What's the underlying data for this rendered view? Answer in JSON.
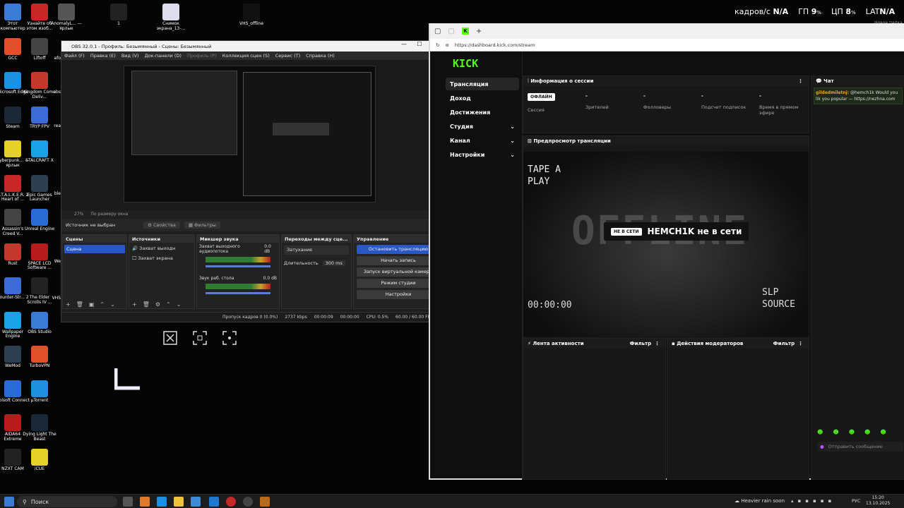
{
  "desktop": {
    "icons_col1": [
      "Этот компьютер",
      "GCC",
      "Microsoft Edge",
      "Steam",
      "Cyberpunk... — ярлык",
      "S.T.A.L.K.E.R. 2 Heart of ...",
      "Assassin's Creed V...",
      "Rust",
      "Counter-Str... 2",
      "Wallpaper Engine",
      "WeMod",
      "Ubisoft Connect",
      "AIDA64 Extreme",
      "NZXT CAM"
    ],
    "icons_col2": [
      "Узнайте об этом изоб...",
      "Liftoff",
      "Kingdom Come Deliv...",
      "TRYP FPV",
      "STALCRAFT X",
      "Epic Games Launcher",
      "Unreal Engine",
      "SPACE LCD Software ...",
      "The Elder Scrolls IV ...",
      "OBS Studio",
      "TurboVPN",
      "µTorrent",
      "Dying Light The Beast",
      "iCUE"
    ],
    "icons_top": [
      "AnomalyL... — ярлык",
      "1",
      "Снимок экрана_13-...",
      "VHS_offline"
    ],
    "col3_partial": [
      "afo",
      "abs",
      "rea",
      "ble",
      "We",
      "VHS"
    ],
    "overlay": {
      "fps_label": "кадров/с",
      "fps_value": "N/A",
      "gpu_label": "ГП",
      "gpu_value": "9",
      "cpu_label": "ЦП",
      "cpu_value": "8",
      "lat_label": "LAT",
      "lat_value": "N/A",
      "pct": "%",
      "right_note": "Новое папка"
    },
    "preview_overlay_icons": [
      "close-square",
      "fullscreen",
      "select-region"
    ]
  },
  "obs": {
    "title": "OBS 32.0.1 - Профиль: Безымянный - Сцены: Безымянный",
    "menu": [
      "Файл (F)",
      "Правка (E)",
      "Вид (V)",
      "Док-панели (D)",
      "Профиль (P)",
      "Коллекция сцен (S)",
      "Сервис (T)",
      "Справка (H)"
    ],
    "zoom": "27%",
    "zoom_mode": "По размеру окна",
    "source_none": "Источник не выбран",
    "props_btn": "Свойства",
    "filters_btn": "Фильтры",
    "docks": {
      "scenes": "Сцены",
      "sources": "Источники",
      "mixer": "Микшер звука",
      "transitions": "Переходы между сце...",
      "controls": "Управление"
    },
    "scene_item": "Сцена",
    "sources": [
      "Захват выходн",
      "Захват экрана"
    ],
    "mixer": [
      {
        "name": "Захват выходного аудиопотока",
        "db": "0.0 dB"
      },
      {
        "name": "Звук раб. стола",
        "db": "0.0 dB"
      }
    ],
    "transition": "Затухание",
    "duration_label": "Длительность",
    "duration_value": "300 ms",
    "controls": [
      "Остановить трансляцию",
      "Начать запись",
      "Запуск виртуальной камеры",
      "Режим студии",
      "Настройки"
    ],
    "status": {
      "dropped": "Пропуск кадров 0 (0.0%)",
      "kbps": "2737 kbps",
      "time1": "00:00:09",
      "time2": "00:00:00",
      "cpu": "CPU: 0.5%",
      "fps": "60.00 / 60.00 FPS"
    }
  },
  "browser": {
    "url": "https://dashboard.kick.com/stream",
    "kick": {
      "logo": "KICK",
      "nav": [
        "Трансляция",
        "Доход",
        "Достижения",
        "Студия",
        "Канал",
        "Настройки"
      ],
      "session_title": "Информация о сессии",
      "badge": "ОФЛАЙН",
      "stats": [
        {
          "v": "",
          "l": "Сессия"
        },
        {
          "v": "-",
          "l": "Зрителей"
        },
        {
          "v": "-",
          "l": "Фолловеры"
        },
        {
          "v": "-",
          "l": "Подсчет подписок"
        },
        {
          "v": "-",
          "l": "Время в прямом эфире"
        }
      ],
      "preview_title": "Предпросмотр трансляции",
      "preview": {
        "tape": "TAPE A",
        "play": "PLAY",
        "offline": "OFFLINE",
        "timecode": "00:00:00",
        "slp": "SLP",
        "source": "SOURCE",
        "badge": "НЕ В СЕТИ",
        "msg": "HEMCH1K не в сети"
      },
      "activity_title": "Лента активности",
      "filter": "Фильтр",
      "mod_title": "Действия модераторов",
      "chat_title": "Чат",
      "chat_user": "gildedmiletnj:",
      "chat_msg": "@hemch1k Would you lik you popular — https://nezhna.com",
      "chat_placeholder": "Отправить сообщение"
    }
  },
  "taskbar": {
    "search": "Поиск",
    "weather": "Heavier rain soon",
    "lang": "РУС",
    "time": "15:20",
    "date": "13.10.2025"
  },
  "colors": {
    "kick_green": "#53fc18",
    "obs_button_blue": "#2a57c6"
  }
}
